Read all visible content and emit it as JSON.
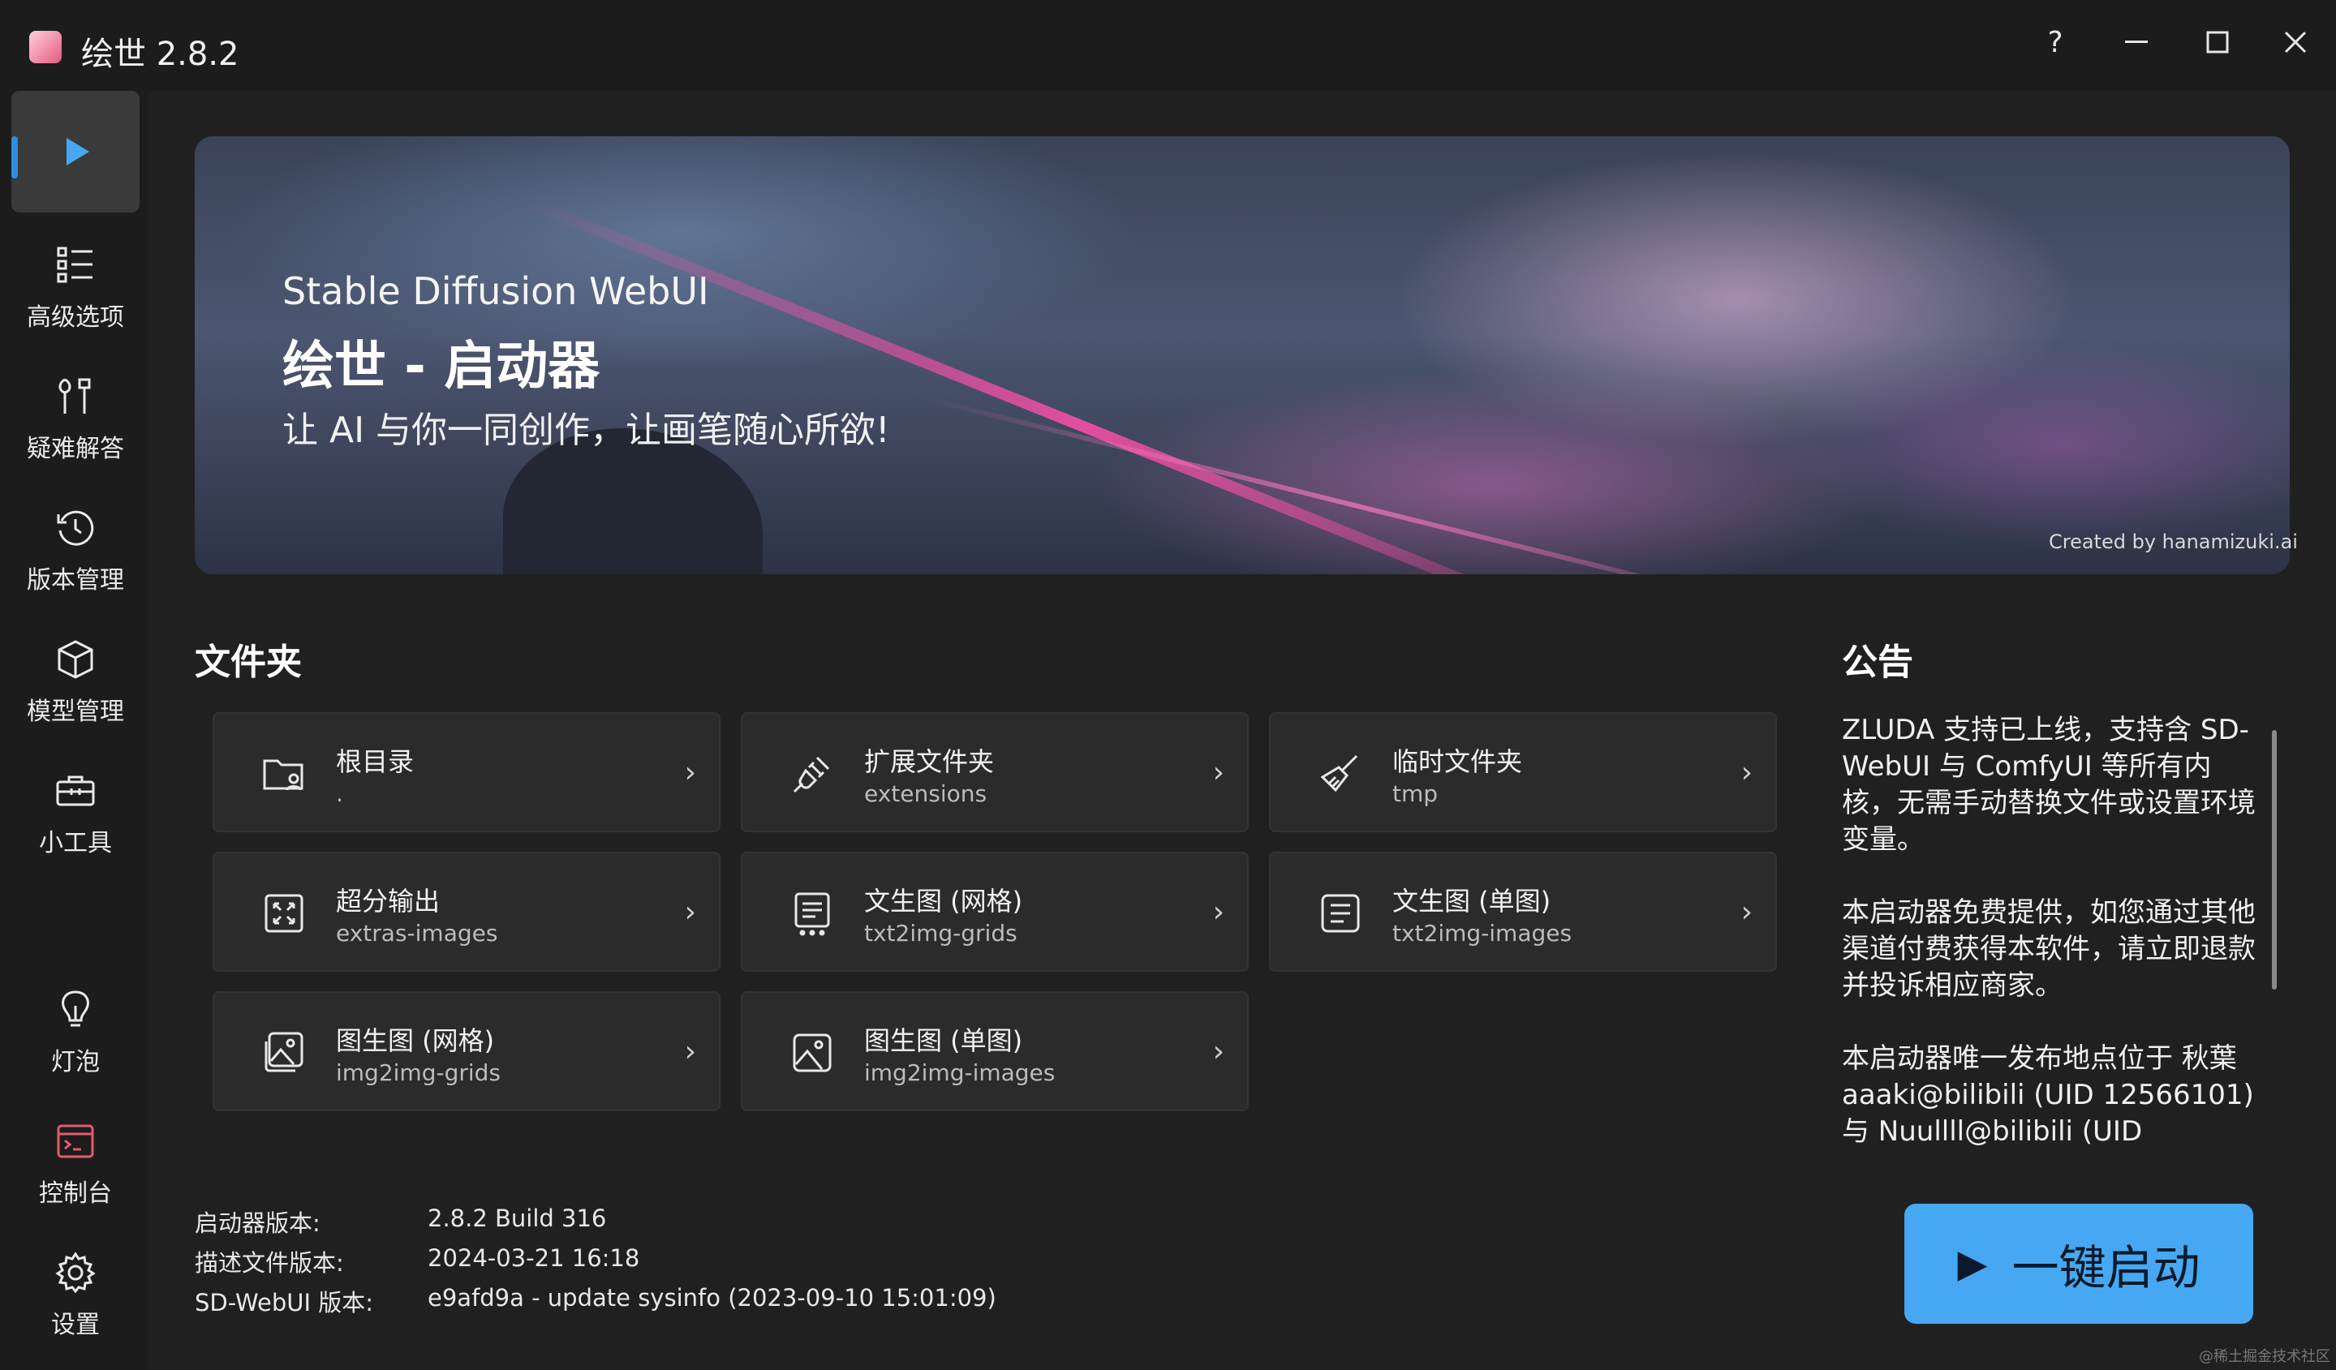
{
  "window": {
    "title": "绘世 2.8.2"
  },
  "sidebar": {
    "items": [
      {
        "label": "",
        "icon": "play-icon"
      },
      {
        "label": "高级选项",
        "icon": "list-icon"
      },
      {
        "label": "疑难解答",
        "icon": "tools-icon"
      },
      {
        "label": "版本管理",
        "icon": "history-icon"
      },
      {
        "label": "模型管理",
        "icon": "cube-icon"
      },
      {
        "label": "小工具",
        "icon": "toolbox-icon"
      },
      {
        "label": "灯泡",
        "icon": "lightbulb-icon"
      },
      {
        "label": "控制台",
        "icon": "console-icon"
      },
      {
        "label": "设置",
        "icon": "gear-icon"
      }
    ]
  },
  "banner": {
    "subtitle": "Stable Diffusion WebUI",
    "title": "绘世 - 启动器",
    "slogan": "让 AI 与你一同创作，让画笔随心所欲!",
    "credit": "Created by hanamizuki.ai"
  },
  "folders": {
    "heading": "文件夹",
    "items": [
      {
        "title": "根目录",
        "path": ".",
        "icon": "folder-user-icon"
      },
      {
        "title": "扩展文件夹",
        "path": "extensions",
        "icon": "plug-icon"
      },
      {
        "title": "临时文件夹",
        "path": "tmp",
        "icon": "broom-icon"
      },
      {
        "title": "超分输出",
        "path": "extras-images",
        "icon": "upscale-icon"
      },
      {
        "title": "文生图 (网格)",
        "path": "txt2img-grids",
        "icon": "text-grid-icon"
      },
      {
        "title": "文生图 (单图)",
        "path": "txt2img-images",
        "icon": "text-doc-icon"
      },
      {
        "title": "图生图 (网格)",
        "path": "img2img-grids",
        "icon": "image-grid-icon"
      },
      {
        "title": "图生图 (单图)",
        "path": "img2img-images",
        "icon": "image-icon"
      }
    ]
  },
  "notice": {
    "heading": "公告",
    "paragraphs": [
      "ZLUDA 支持已上线，支持含 SD-WebUI 与 ComfyUI 等所有内核，无需手动替换文件或设置环境变量。",
      "本启动器免费提供，如您通过其他渠道付费获得本软件，请立即退款并投诉相应商家。",
      "本启动器唯一发布地点位于 秋葉 aaaki@bilibili (UID 12566101) 与 Nuullll@bilibili (UID"
    ]
  },
  "versions": [
    {
      "label": "启动器版本:",
      "value": "2.8.2 Build 316"
    },
    {
      "label": "描述文件版本:",
      "value": "2024-03-21 16:18"
    },
    {
      "label": "SD-WebUI 版本:",
      "value": "e9afd9a - update sysinfo (2023-09-10 15:01:09)"
    }
  ],
  "launch": {
    "label": "一键启动",
    "icon": "play-icon"
  },
  "watermark": "@稀土掘金技术社区",
  "colors": {
    "accent": "#46a8f2",
    "indicator": "#2f8ee0",
    "background": "#202020"
  }
}
